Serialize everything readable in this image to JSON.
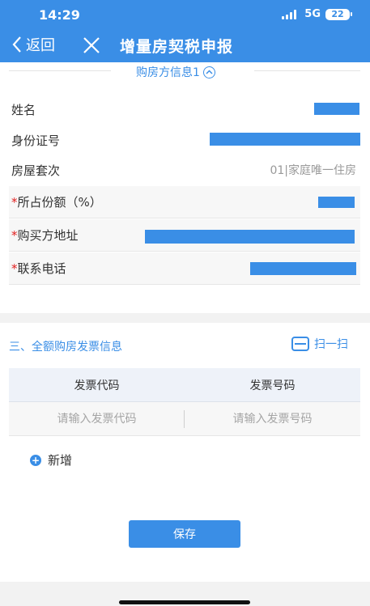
{
  "status_bar": {
    "time": "14:29",
    "network": "5G",
    "battery": "22"
  },
  "nav": {
    "back_label": "返回",
    "title": "增量房契税申报"
  },
  "buyer_section": {
    "title": "购房方信息1",
    "rows": [
      {
        "label": "姓名",
        "required": false
      },
      {
        "label": "身份证号",
        "required": false
      },
      {
        "label": "房屋套次",
        "required": false,
        "value": "01|家庭唯一住房"
      },
      {
        "label": "所占份额（%）",
        "required": true
      },
      {
        "label": "购买方地址",
        "required": true
      },
      {
        "label": "联系电话",
        "required": true
      }
    ]
  },
  "invoice_section": {
    "title": "三、全额购房发票信息",
    "scan_label": "扫一扫",
    "columns": [
      "发票代码",
      "发票号码"
    ],
    "placeholders": {
      "code": "请输入发票代码",
      "number": "请输入发票号码"
    },
    "add_label": "新增",
    "save_label": "保存"
  },
  "colors": {
    "primary": "#3a8ee6",
    "required": "#e02020"
  }
}
